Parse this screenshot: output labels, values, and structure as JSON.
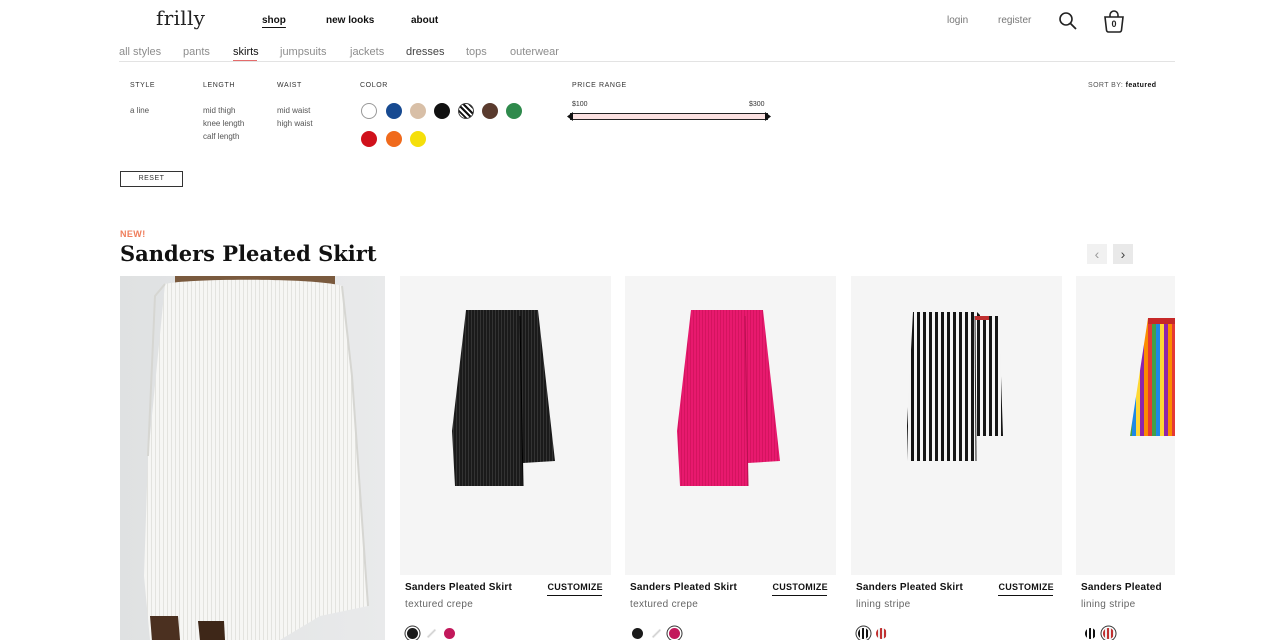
{
  "header": {
    "logo": "frilly",
    "nav": [
      "shop",
      "new looks",
      "about"
    ],
    "login": "login",
    "register": "register",
    "cart_count": "0"
  },
  "categories": [
    "all styles",
    "pants",
    "skirts",
    "jumpsuits",
    "jackets",
    "dresses",
    "tops",
    "outerwear"
  ],
  "active_category": "skirts",
  "filters": {
    "style": {
      "label": "STYLE",
      "options": [
        "a line"
      ]
    },
    "length": {
      "label": "LENGTH",
      "options": [
        "mid thigh",
        "knee length",
        "calf length"
      ]
    },
    "waist": {
      "label": "WAIST",
      "options": [
        "mid waist",
        "high waist"
      ]
    },
    "color": {
      "label": "COLOR",
      "swatches": [
        "#ffffff",
        "#174a91",
        "#d8bfa7",
        "#111111",
        "pattern-stripe",
        "#5a3b2e",
        "#2f8a4c",
        "#d0111b",
        "#f06a1c",
        "#f5df0a"
      ]
    },
    "price": {
      "label": "PRICE RANGE",
      "min": "$100",
      "max": "$300"
    },
    "sort_label": "SORT BY:",
    "sort_value": "featured",
    "reset": "RESET"
  },
  "product": {
    "badge": "NEW!",
    "title": "Sanders Pleated Skirt"
  },
  "cards": [
    {
      "name": "Sanders Pleated Skirt",
      "sub": "textured crepe",
      "customize": "CUSTOMIZE",
      "color": "#151515",
      "variants": [
        "#1a1a1a",
        "#eeeeee",
        "#c2185b"
      ],
      "selected": 0
    },
    {
      "name": "Sanders Pleated Skirt",
      "sub": "textured crepe",
      "customize": "CUSTOMIZE",
      "color": "#e8196e",
      "variants": [
        "#1a1a1a",
        "#eeeeee",
        "#c2185b"
      ],
      "selected": 2
    },
    {
      "name": "Sanders Pleated Skirt",
      "sub": "lining stripe",
      "customize": "CUSTOMIZE",
      "color": "stripe-bw",
      "variants": [
        "stripe-bw",
        "stripe-red"
      ],
      "selected": 0
    },
    {
      "name": "Sanders Pleated",
      "sub": "lining stripe",
      "customize": "",
      "color": "stripe-rainbow",
      "variants": [
        "stripe-bw",
        "stripe-red"
      ],
      "selected": 1
    }
  ]
}
